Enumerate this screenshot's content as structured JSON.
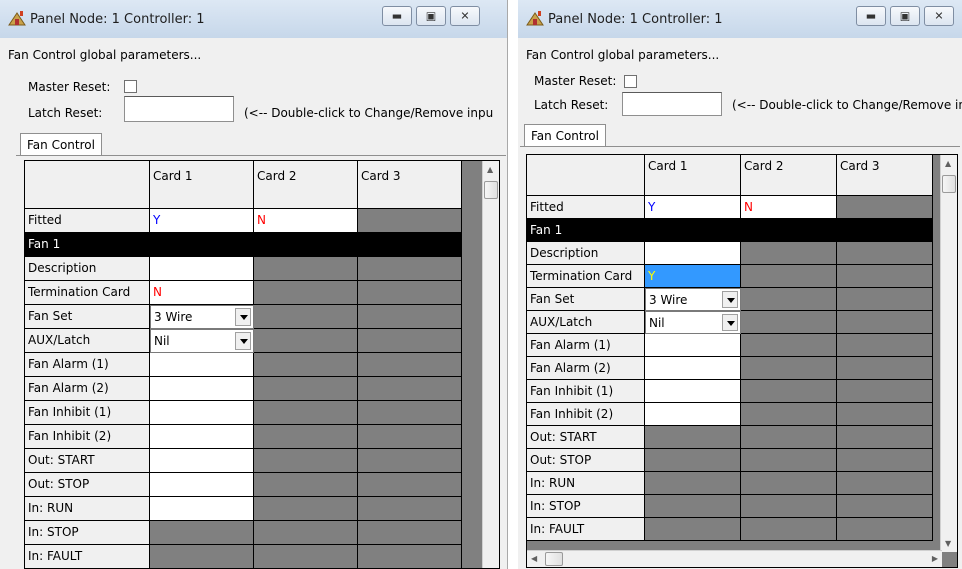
{
  "windows": [
    {
      "title": "Panel Node: 1 Controller: 1",
      "heading": "Fan Control global parameters...",
      "master_reset_label": "Master Reset:",
      "latch_reset_label": "Latch Reset:",
      "latch_reset_value": "",
      "latch_hint": "(<-- Double-click to Change/Remove inpu",
      "tab": "Fan Control",
      "columns": [
        "",
        "Card 1",
        "Card 2",
        "Card 3"
      ],
      "rows": [
        {
          "label": "Fitted",
          "c1": "Y",
          "c2": "N"
        },
        {
          "label": "Fan 1"
        },
        {
          "label": "Description"
        },
        {
          "label": "Termination Card",
          "c1": "N"
        },
        {
          "label": "Fan Set",
          "c1": "3 Wire"
        },
        {
          "label": "AUX/Latch",
          "c1": "Nil"
        },
        {
          "label": "Fan Alarm (1)"
        },
        {
          "label": "Fan Alarm (2)"
        },
        {
          "label": "Fan Inhibit (1)"
        },
        {
          "label": "Fan Inhibit (2)"
        },
        {
          "label": "Out: START"
        },
        {
          "label": "Out: STOP"
        },
        {
          "label": "In: RUN"
        },
        {
          "label": "In: STOP"
        },
        {
          "label": "In: FAULT"
        }
      ]
    },
    {
      "title": "Panel Node: 1 Controller: 1",
      "heading": "Fan Control global parameters...",
      "master_reset_label": "Master Reset:",
      "latch_reset_label": "Latch Reset:",
      "latch_reset_value": "",
      "latch_hint": "(<-- Double-click to Change/Remove inpu",
      "tab": "Fan Control",
      "columns": [
        "",
        "Card 1",
        "Card 2",
        "Card 3"
      ],
      "rows": [
        {
          "label": "Fitted",
          "c1": "Y",
          "c2": "N"
        },
        {
          "label": "Fan 1"
        },
        {
          "label": "Description"
        },
        {
          "label": "Termination Card",
          "c1": "Y"
        },
        {
          "label": "Fan Set",
          "c1": "3 Wire"
        },
        {
          "label": "AUX/Latch",
          "c1": "Nil"
        },
        {
          "label": "Fan Alarm (1)"
        },
        {
          "label": "Fan Alarm (2)"
        },
        {
          "label": "Fan Inhibit (1)"
        },
        {
          "label": "Fan Inhibit (2)"
        },
        {
          "label": "Out: START"
        },
        {
          "label": "Out: STOP"
        },
        {
          "label": "In: RUN"
        },
        {
          "label": "In: STOP"
        },
        {
          "label": "In: FAULT"
        }
      ]
    }
  ],
  "colors": {
    "title_bg": "#c6d7ea",
    "grid_bg": "#808080",
    "selected": "#3399ff",
    "yes": "#0000ff",
    "no": "#ff0000"
  },
  "icons": [
    "panel-app-icon",
    "minimize-icon",
    "maximize-icon",
    "close-icon",
    "dropdown-arrow-icon",
    "scroll-up-icon",
    "scroll-down-icon",
    "scroll-left-icon",
    "scroll-right-icon"
  ]
}
